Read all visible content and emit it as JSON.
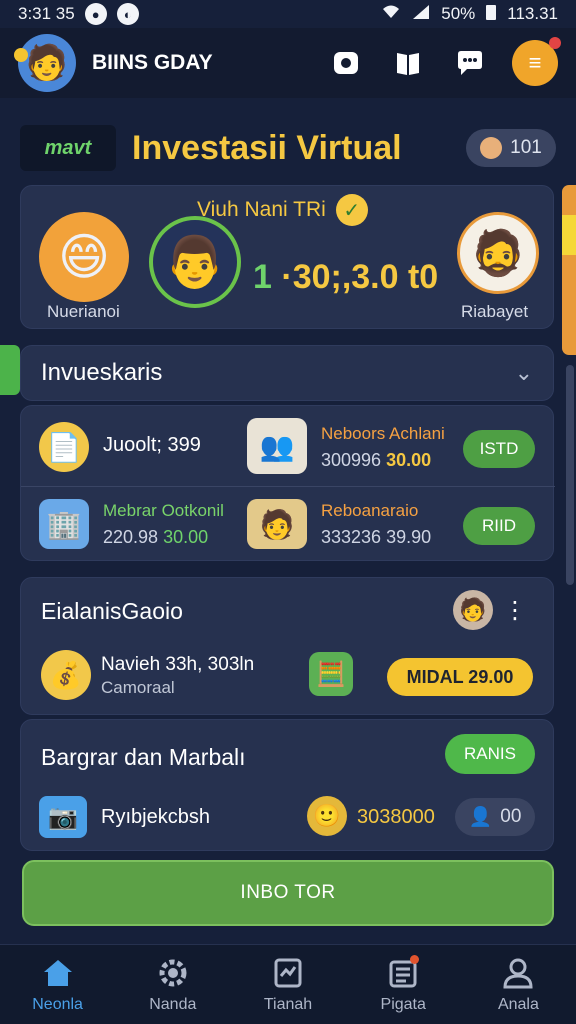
{
  "status": {
    "time": "3:31 35",
    "battery": "50%",
    "right_time": "113.31"
  },
  "header": {
    "username": "BIINS GDAY"
  },
  "title": {
    "logo_text": "mavt",
    "text": "Investasii Virtual",
    "member_count": "101"
  },
  "hero": {
    "title": "Viuh Nani TRi",
    "left_label": "Nuerianoi",
    "value_lead": "1",
    "value": " ·30;,3.0 t0",
    "right_label": "Riabayet"
  },
  "investments": {
    "heading": "Invueskaris",
    "rows": [
      {
        "title": "Juoolt; 399",
        "right_title": "Neboors Achlani",
        "right_sub": "300996",
        "right_value": "30.00",
        "button": "ISTD"
      },
      {
        "title": "Mebrar Ootkonil",
        "sub_a": "220.98",
        "sub_b": "30.00",
        "right_title": "Reboanaraio",
        "right_sub": "333236",
        "right_value": "39.90",
        "button": "RIID"
      }
    ]
  },
  "balance": {
    "title": "EialanisGaoio",
    "name": "Navieh 33h, 303ln",
    "sub": "Camoraal",
    "button": "MIDAL 29.00"
  },
  "bargain": {
    "title": "Bargrar dan Marbalı",
    "button": "RANIS",
    "name": "Ryıbjekcbsh",
    "value": "3038000",
    "count": "00"
  },
  "cta": {
    "label": "INBO TOR"
  },
  "tabs": [
    {
      "label": "Neonla"
    },
    {
      "label": "Nanda"
    },
    {
      "label": "Tianah"
    },
    {
      "label": "Pigata"
    },
    {
      "label": "Anala"
    }
  ],
  "colors": {
    "background": "#16203a",
    "accent_yellow": "#f5c842",
    "accent_green": "#4e9f44",
    "active_tab": "#4aa0e8"
  }
}
